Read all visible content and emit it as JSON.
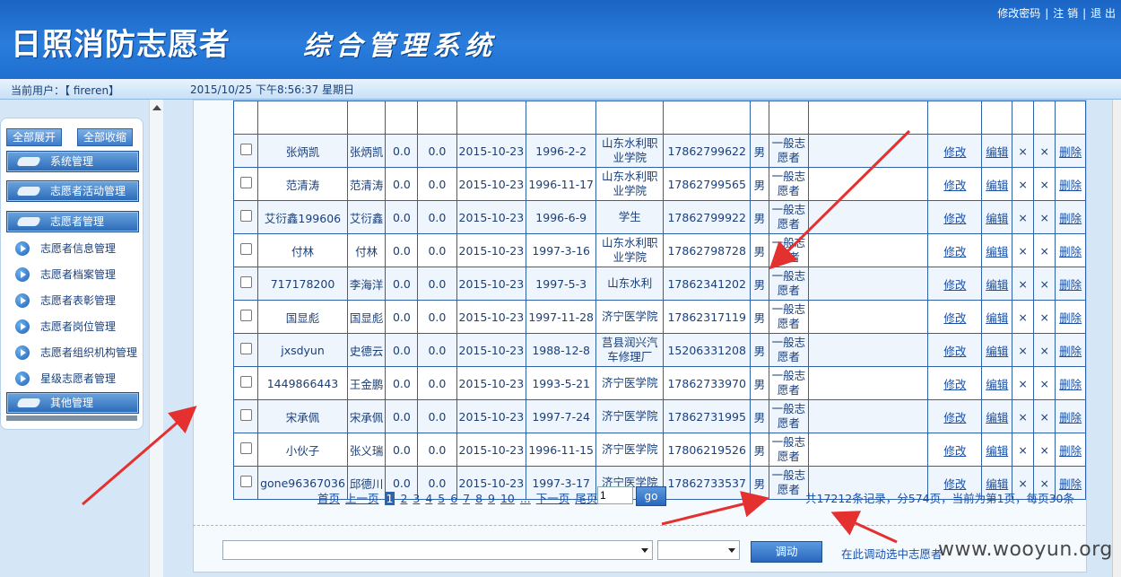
{
  "header": {
    "logo": "日照消防志愿者",
    "subtitle": "综合管理系统",
    "links": [
      "修改密码",
      "注 销",
      "退 出"
    ]
  },
  "status": {
    "user": "当前用户：【 fireren】",
    "time": "2015/10/25 下午8:56:37 星期日"
  },
  "sidebar": {
    "expand_all": "全部展开",
    "collapse_all": "全部收缩",
    "heads": [
      "系统管理",
      "志愿者活动管理",
      "志愿者管理"
    ],
    "items": [
      "志愿者信息管理",
      "志愿者档案管理",
      "志愿者表彰管理",
      "志愿者岗位管理",
      "志愿者组织机构管理",
      "星级志愿者管理"
    ],
    "other": "其他管理"
  },
  "table": {
    "actions": [
      "修改",
      "编辑",
      "×",
      "×",
      "删除"
    ],
    "rows": [
      {
        "account": "张炳凯",
        "name": "张炳凯",
        "a": "0.0",
        "b": "0.0",
        "reg": "2015-10-23",
        "birth": "1996-2-2",
        "unit": "山东水利职业学院",
        "phone": "17862799622",
        "sex": "男",
        "type": "一般志愿者"
      },
      {
        "account": "范清涛",
        "name": "范清涛",
        "a": "0.0",
        "b": "0.0",
        "reg": "2015-10-23",
        "birth": "1996-11-17",
        "unit": "山东水利职业学院",
        "phone": "17862799565",
        "sex": "男",
        "type": "一般志愿者"
      },
      {
        "account": "艾衍鑫199606",
        "name": "艾衍鑫",
        "a": "0.0",
        "b": "0.0",
        "reg": "2015-10-23",
        "birth": "1996-6-9",
        "unit": "学生",
        "phone": "17862799922",
        "sex": "男",
        "type": "一般志愿者"
      },
      {
        "account": "付林",
        "name": "付林",
        "a": "0.0",
        "b": "0.0",
        "reg": "2015-10-23",
        "birth": "1997-3-16",
        "unit": "山东水利职业学院",
        "phone": "17862798728",
        "sex": "男",
        "type": "一般志愿者"
      },
      {
        "account": "717178200",
        "name": "李海洋",
        "a": "0.0",
        "b": "0.0",
        "reg": "2015-10-23",
        "birth": "1997-5-3",
        "unit": "山东水利",
        "phone": "17862341202",
        "sex": "男",
        "type": "一般志愿者"
      },
      {
        "account": "国显彪",
        "name": "国显彪",
        "a": "0.0",
        "b": "0.0",
        "reg": "2015-10-23",
        "birth": "1997-11-28",
        "unit": "济宁医学院",
        "phone": "17862317119",
        "sex": "男",
        "type": "一般志愿者"
      },
      {
        "account": "jxsdyun",
        "name": "史德云",
        "a": "0.0",
        "b": "0.0",
        "reg": "2015-10-23",
        "birth": "1988-12-8",
        "unit": "莒县润兴汽车修理厂",
        "phone": "15206331208",
        "sex": "男",
        "type": "一般志愿者"
      },
      {
        "account": "1449866443",
        "name": "王金鹏",
        "a": "0.0",
        "b": "0.0",
        "reg": "2015-10-23",
        "birth": "1993-5-21",
        "unit": "济宁医学院",
        "phone": "17862733970",
        "sex": "男",
        "type": "一般志愿者"
      },
      {
        "account": "宋承佩",
        "name": "宋承佩",
        "a": "0.0",
        "b": "0.0",
        "reg": "2015-10-23",
        "birth": "1997-7-24",
        "unit": "济宁医学院",
        "phone": "17862731995",
        "sex": "男",
        "type": "一般志愿者"
      },
      {
        "account": "小伙子",
        "name": "张义瑞",
        "a": "0.0",
        "b": "0.0",
        "reg": "2015-10-23",
        "birth": "1996-11-15",
        "unit": "济宁医学院",
        "phone": "17806219526",
        "sex": "男",
        "type": "一般志愿者"
      },
      {
        "account": "gone96367036",
        "name": "邱德川",
        "a": "0.0",
        "b": "0.0",
        "reg": "2015-10-23",
        "birth": "1997-3-17",
        "unit": "济宁医学院",
        "phone": "17862733537",
        "sex": "男",
        "type": "一般志愿者"
      }
    ]
  },
  "pager": {
    "first": "首页",
    "prev": "上一页",
    "pages": [
      "1",
      "2",
      "3",
      "4",
      "5",
      "6",
      "7",
      "8",
      "9",
      "10"
    ],
    "more": "...",
    "next": "下一页",
    "last": "尾页",
    "input_value": "1",
    "go": "go",
    "summary": "共17212条记录，分574页，当前为第1页，每页30条"
  },
  "bottom": {
    "button": "调动",
    "hint": "在此调动选中志愿者"
  },
  "watermark": "www.wooyun.org"
}
